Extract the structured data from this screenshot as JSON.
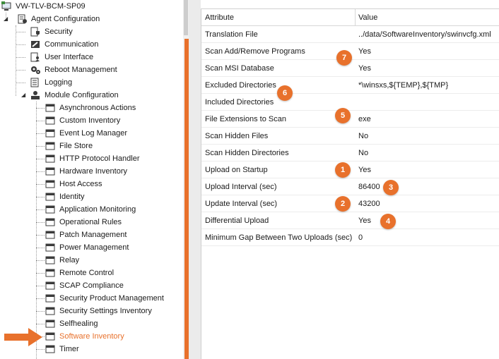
{
  "tree": {
    "root": "VW-TLV-BCM-SP09",
    "agent_configuration": "Agent Configuration",
    "agent_children": [
      "Security",
      "Communication",
      "User Interface",
      "Reboot Management",
      "Logging"
    ],
    "module_configuration": "Module Configuration",
    "modules": [
      "Asynchronous Actions",
      "Custom Inventory",
      "Event Log Manager",
      "File Store",
      "HTTP Protocol Handler",
      "Hardware Inventory",
      "Host Access",
      "Identity",
      "Application Monitoring",
      "Operational Rules",
      "Patch Management",
      "Power Management",
      "Relay",
      "Remote Control",
      "SCAP Compliance",
      "Security Product Management",
      "Security Settings Inventory",
      "Selfhealing",
      "Software Inventory",
      "Timer"
    ],
    "selected": "Software Inventory"
  },
  "grid": {
    "col_attribute": "Attribute",
    "col_value": "Value",
    "rows": [
      {
        "attribute": "Translation File",
        "value": "../data/SoftwareInventory/swinvcfg.xml"
      },
      {
        "attribute": "Scan Add/Remove Programs",
        "value": "Yes"
      },
      {
        "attribute": "Scan MSI Database",
        "value": "Yes"
      },
      {
        "attribute": "Excluded Directories",
        "value": "*\\winsxs,${TEMP},${TMP}"
      },
      {
        "attribute": "Included Directories",
        "value": ""
      },
      {
        "attribute": "File Extensions to Scan",
        "value": "exe"
      },
      {
        "attribute": "Scan Hidden Files",
        "value": "No"
      },
      {
        "attribute": "Scan Hidden Directories",
        "value": "No"
      },
      {
        "attribute": "Upload on Startup",
        "value": "Yes"
      },
      {
        "attribute": "Upload Interval (sec)",
        "value": "86400"
      },
      {
        "attribute": "Update Interval (sec)",
        "value": "43200"
      },
      {
        "attribute": "Differential Upload",
        "value": "Yes"
      },
      {
        "attribute": "Minimum Gap Between Two Uploads (sec)",
        "value": "0"
      }
    ]
  },
  "callouts": [
    "7",
    "6",
    "5",
    "1",
    "3",
    "2",
    "4"
  ],
  "colors": {
    "accent": "#e8712c"
  }
}
